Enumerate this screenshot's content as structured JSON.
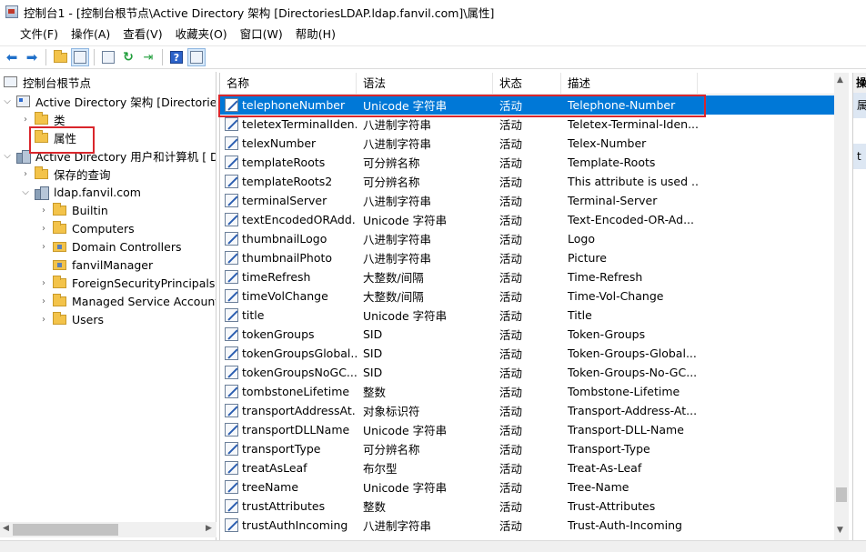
{
  "window": {
    "title": "控制台1 - [控制台根节点\\Active Directory 架构 [DirectoriesLDAP.ldap.fanvil.com]\\属性]"
  },
  "menu": [
    "文件(F)",
    "操作(A)",
    "查看(V)",
    "收藏夹(O)",
    "窗口(W)",
    "帮助(H)"
  ],
  "toolbar": {
    "icons": [
      "back-arrow-icon",
      "forward-arrow-icon",
      "up-folder-icon",
      "show-hide-tree-icon",
      "properties-icon",
      "refresh-icon",
      "export-list-icon",
      "help-icon",
      "show-hide-action-pane-icon"
    ]
  },
  "tree": {
    "root": "控制台根节点",
    "schema": "Active Directory 架构 [DirectoriesL",
    "classes": "类",
    "attributes": "属性",
    "users_computers": "Active Directory 用户和计算机 [ Dir",
    "saved_queries": "保存的查询",
    "domain": "ldap.fanvil.com",
    "children": [
      "Builtin",
      "Computers",
      "Domain Controllers",
      "fanvilManager",
      "ForeignSecurityPrincipals",
      "Managed Service Accounts",
      "Users"
    ]
  },
  "list": {
    "columns": [
      "名称",
      "语法",
      "状态",
      "描述"
    ],
    "rows": [
      {
        "name": "telephoneNumber",
        "syntax": "Unicode 字符串",
        "state": "活动",
        "desc": "Telephone-Number",
        "selected": true
      },
      {
        "name": "teletexTerminalIden...",
        "syntax": "八进制字符串",
        "state": "活动",
        "desc": "Teletex-Terminal-Iden..."
      },
      {
        "name": "telexNumber",
        "syntax": "八进制字符串",
        "state": "活动",
        "desc": "Telex-Number"
      },
      {
        "name": "templateRoots",
        "syntax": "可分辨名称",
        "state": "活动",
        "desc": "Template-Roots"
      },
      {
        "name": "templateRoots2",
        "syntax": "可分辨名称",
        "state": "活动",
        "desc": "This attribute is used ..."
      },
      {
        "name": "terminalServer",
        "syntax": "八进制字符串",
        "state": "活动",
        "desc": "Terminal-Server"
      },
      {
        "name": "textEncodedORAdd...",
        "syntax": "Unicode 字符串",
        "state": "活动",
        "desc": "Text-Encoded-OR-Ad..."
      },
      {
        "name": "thumbnailLogo",
        "syntax": "八进制字符串",
        "state": "活动",
        "desc": "Logo"
      },
      {
        "name": "thumbnailPhoto",
        "syntax": "八进制字符串",
        "state": "活动",
        "desc": "Picture"
      },
      {
        "name": "timeRefresh",
        "syntax": "大整数/间隔",
        "state": "活动",
        "desc": "Time-Refresh"
      },
      {
        "name": "timeVolChange",
        "syntax": "大整数/间隔",
        "state": "活动",
        "desc": "Time-Vol-Change"
      },
      {
        "name": "title",
        "syntax": "Unicode 字符串",
        "state": "活动",
        "desc": "Title"
      },
      {
        "name": "tokenGroups",
        "syntax": "SID",
        "state": "活动",
        "desc": "Token-Groups"
      },
      {
        "name": "tokenGroupsGlobal...",
        "syntax": "SID",
        "state": "活动",
        "desc": "Token-Groups-Global..."
      },
      {
        "name": "tokenGroupsNoGC...",
        "syntax": "SID",
        "state": "活动",
        "desc": "Token-Groups-No-GC..."
      },
      {
        "name": "tombstoneLifetime",
        "syntax": "整数",
        "state": "活动",
        "desc": "Tombstone-Lifetime"
      },
      {
        "name": "transportAddressAt...",
        "syntax": "对象标识符",
        "state": "活动",
        "desc": "Transport-Address-At..."
      },
      {
        "name": "transportDLLName",
        "syntax": "Unicode 字符串",
        "state": "活动",
        "desc": "Transport-DLL-Name"
      },
      {
        "name": "transportType",
        "syntax": "可分辨名称",
        "state": "活动",
        "desc": "Transport-Type"
      },
      {
        "name": "treatAsLeaf",
        "syntax": "布尔型",
        "state": "活动",
        "desc": "Treat-As-Leaf"
      },
      {
        "name": "treeName",
        "syntax": "Unicode 字符串",
        "state": "活动",
        "desc": "Tree-Name"
      },
      {
        "name": "trustAttributes",
        "syntax": "整数",
        "state": "活动",
        "desc": "Trust-Attributes"
      },
      {
        "name": "trustAuthIncoming",
        "syntax": "八进制字符串",
        "state": "活动",
        "desc": "Trust-Auth-Incoming"
      }
    ]
  },
  "actions": {
    "header": "操",
    "item1": "属",
    "item2": "t"
  },
  "colors": {
    "selection": "#0078d7",
    "highlight_box": "#d9262c"
  }
}
